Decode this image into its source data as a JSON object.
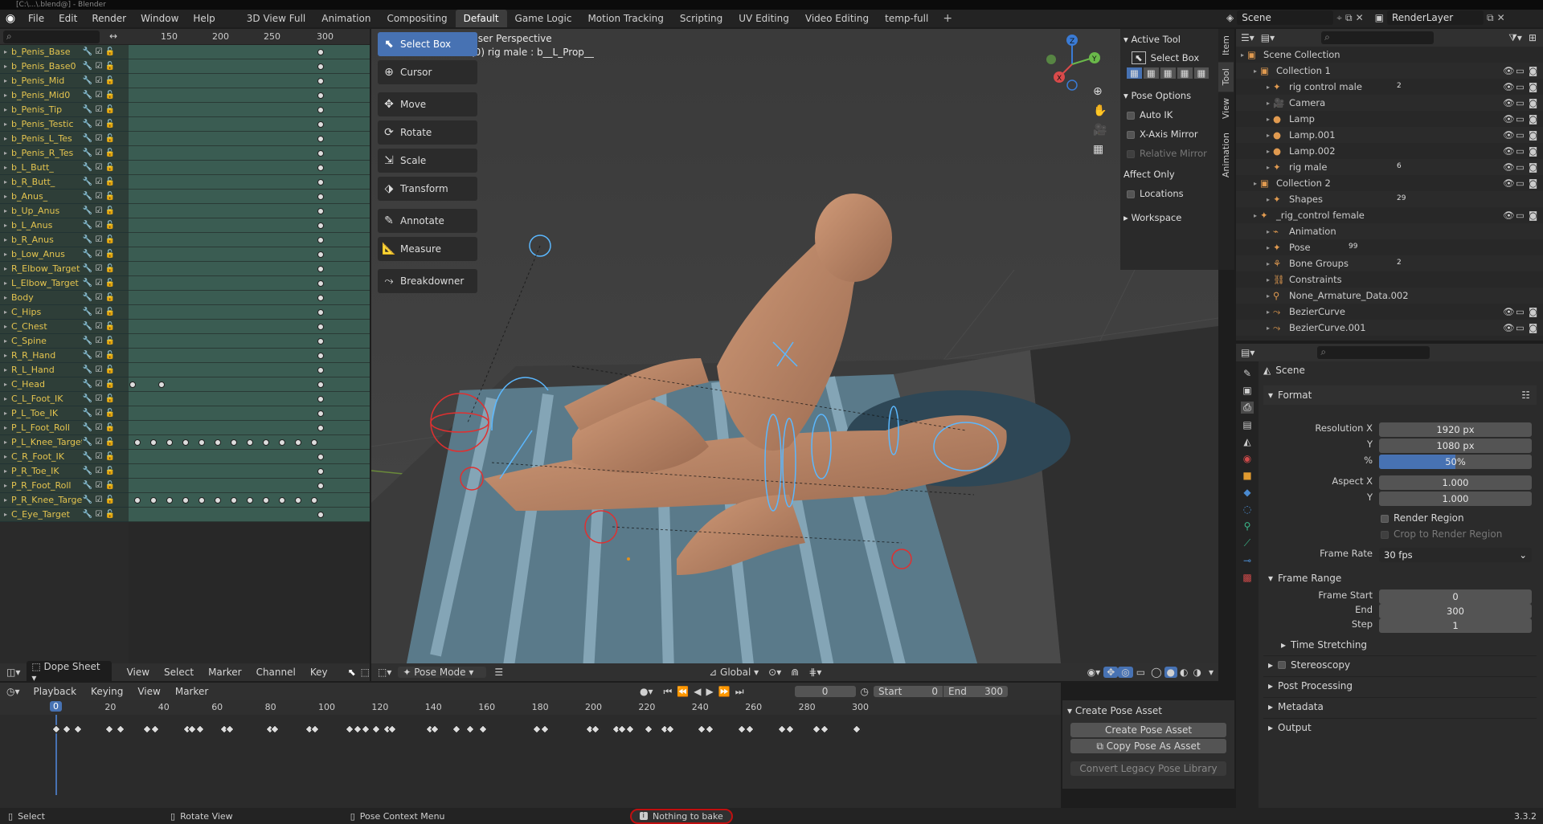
{
  "title_bar": "[C:\\...\\.blend@] - Blender",
  "menu": [
    "File",
    "Edit",
    "Render",
    "Window",
    "Help"
  ],
  "workspaces": [
    "3D View Full",
    "Animation",
    "Compositing",
    "Default",
    "Game Logic",
    "Motion Tracking",
    "Scripting",
    "UV Editing",
    "Video Editing",
    "temp-full"
  ],
  "active_workspace": "Default",
  "scene_name": "Scene",
  "render_layer": "RenderLayer",
  "dopesheet": {
    "ruler": [
      "150",
      "200",
      "250",
      "300"
    ],
    "channels": [
      "b_Penis_Base",
      "b_Penis_Base0",
      "b_Penis_Mid",
      "b_Penis_Mid0",
      "b_Penis_Tip",
      "b_Penis_Testic",
      "b_Penis_L_Tes",
      "b_Penis_R_Tes",
      "b_L_Butt_",
      "b_R_Butt_",
      "b_Anus_",
      "b_Up_Anus",
      "b_L_Anus",
      "b_R_Anus",
      "b_Low_Anus",
      "R_Elbow_Target",
      "L_Elbow_Target",
      "Body",
      "C_Hips",
      "C_Chest",
      "C_Spine",
      "R_R_Hand",
      "R_L_Hand",
      "C_Head",
      "C_L_Foot_IK",
      "P_L_Toe_IK",
      "P_L_Foot_Roll",
      "P_L_Knee_Target",
      "C_R_Foot_IK",
      "P_R_Toe_IK",
      "P_R_Foot_Roll",
      "P_R_Knee_Target",
      "C_Eye_Target"
    ],
    "editor": "Dope Sheet",
    "menus": [
      "View",
      "Select",
      "Marker",
      "Channel",
      "Key"
    ]
  },
  "viewport": {
    "label1": "User Perspective",
    "label2": "(0) rig male : b__L_Prop__",
    "tools": [
      "Select Box",
      "Cursor",
      "Move",
      "Rotate",
      "Scale",
      "Transform",
      "Annotate",
      "Measure",
      "Breakdowner"
    ],
    "mode": "Pose Mode",
    "orientation": "Global"
  },
  "npanel": {
    "active_tool": "Active Tool",
    "select_box": "Select Box",
    "pose_options": "Pose Options",
    "auto_ik": "Auto IK",
    "x_mirror": "X-Axis Mirror",
    "relative_mirror": "Relative Mirror",
    "affect_only": "Affect Only",
    "locations": "Locations",
    "workspace": "Workspace",
    "tabs": [
      "Item",
      "Tool",
      "View",
      "Animation"
    ]
  },
  "outliner": {
    "rows": [
      {
        "label": "Scene Collection",
        "indent": 0
      },
      {
        "label": "Collection 1",
        "indent": 1
      },
      {
        "label": "rig control male",
        "indent": 2
      },
      {
        "label": "Camera",
        "indent": 2
      },
      {
        "label": "Lamp",
        "indent": 2
      },
      {
        "label": "Lamp.001",
        "indent": 2
      },
      {
        "label": "Lamp.002",
        "indent": 2
      },
      {
        "label": "rig male",
        "indent": 2
      },
      {
        "label": "Collection 2",
        "indent": 1
      },
      {
        "label": "Shapes",
        "indent": 2
      },
      {
        "label": "_rig_control female",
        "indent": 1
      },
      {
        "label": "Animation",
        "indent": 2
      },
      {
        "label": "Pose",
        "indent": 2
      },
      {
        "label": "Bone Groups",
        "indent": 2
      },
      {
        "label": "Constraints",
        "indent": 2
      },
      {
        "label": "None_Armature_Data.002",
        "indent": 2
      },
      {
        "label": "BezierCurve",
        "indent": 2
      },
      {
        "label": "BezierCurve.001",
        "indent": 2
      }
    ],
    "badges": {
      "rig_control_male": "2",
      "rig_male": "6",
      "shapes": "29",
      "pose": "99",
      "bone_groups": "2"
    }
  },
  "properties": {
    "header": "Scene",
    "format": "Format",
    "res_x_label": "Resolution X",
    "res_x": "1920 px",
    "res_y_label": "Y",
    "res_y": "1080 px",
    "pct_label": "%",
    "pct": "50%",
    "aspect_x_label": "Aspect X",
    "aspect_x": "1.000",
    "aspect_y_label": "Y",
    "aspect_y": "1.000",
    "render_region": "Render Region",
    "crop": "Crop to Render Region",
    "frame_rate_label": "Frame Rate",
    "frame_rate": "30 fps",
    "frame_range": "Frame Range",
    "frame_start_label": "Frame Start",
    "frame_start": "0",
    "end_label": "End",
    "end": "300",
    "step_label": "Step",
    "step": "1",
    "time_stretching": "Time Stretching",
    "stereoscopy": "Stereoscopy",
    "post_processing": "Post Processing",
    "metadata": "Metadata",
    "output": "Output"
  },
  "timeline": {
    "menus": [
      "Playback",
      "Keying",
      "View",
      "Marker"
    ],
    "current": "0",
    "start_label": "Start",
    "start": "0",
    "end_label": "End",
    "end": "300",
    "ruler": [
      "0",
      "20",
      "40",
      "60",
      "80",
      "100",
      "120",
      "140",
      "160",
      "180",
      "200",
      "220",
      "240",
      "260",
      "280",
      "300"
    ],
    "frame_display": "0"
  },
  "pose_asset": {
    "title": "Create Pose Asset",
    "create": "Create Pose Asset",
    "copy": "Copy Pose As Asset",
    "convert": "Convert Legacy Pose Library"
  },
  "status": {
    "select": "Select",
    "rotate": "Rotate View",
    "context": "Pose Context Menu",
    "message": "Nothing to bake",
    "version": "3.3.2"
  }
}
